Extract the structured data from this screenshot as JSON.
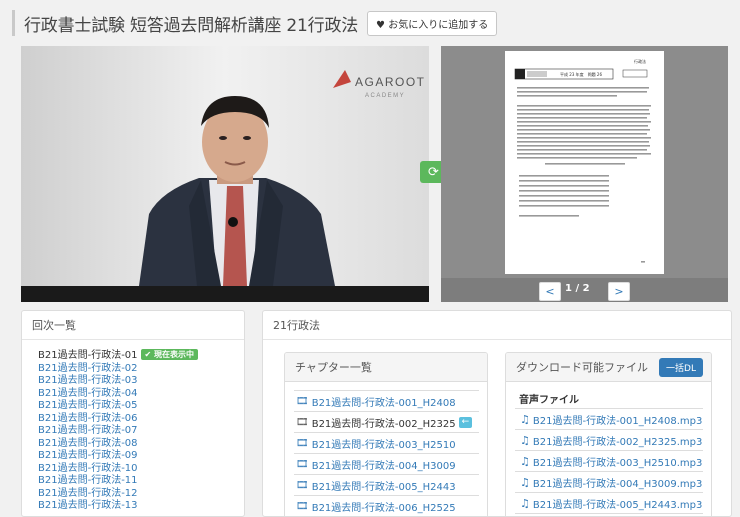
{
  "header": {
    "title": "行政書士試験 短答過去問解析講座 21行政法",
    "favorite_label": "お気に入りに追加する"
  },
  "video": {
    "logo_text": "AGAROOT",
    "logo_sub": "ACADEMY"
  },
  "doc": {
    "page_indicator": "1 / 2",
    "header_small": "行政法",
    "header_box": "平成 23 年度　問題 26",
    "prev": "<",
    "next": ">"
  },
  "episodes": {
    "title": "回次一覧",
    "current_badge": "現在表示中",
    "items": [
      "B21過去問-行政法-01",
      "B21過去問-行政法-02",
      "B21過去問-行政法-03",
      "B21過去問-行政法-04",
      "B21過去問-行政法-05",
      "B21過去問-行政法-06",
      "B21過去問-行政法-07",
      "B21過去問-行政法-08",
      "B21過去問-行政法-09",
      "B21過去問-行政法-10",
      "B21過去問-行政法-11",
      "B21過去問-行政法-12",
      "B21過去問-行政法-13"
    ]
  },
  "course": {
    "title": "21行政法"
  },
  "chapters": {
    "title": "チャプター一覧",
    "items": [
      "B21過去問-行政法-001_H2408",
      "B21過去問-行政法-002_H2325",
      "B21過去問-行政法-003_H2510",
      "B21過去問-行政法-004_H3009",
      "B21過去問-行政法-005_H2443",
      "B21過去問-行政法-006_H2525"
    ]
  },
  "downloads": {
    "title": "ダウンロード可能ファイル",
    "bulk_label": "一括DL",
    "audio_heading": "音声ファイル",
    "items": [
      "B21過去問-行政法-001_H2408.mp3",
      "B21過去問-行政法-002_H2325.mp3",
      "B21過去問-行政法-003_H2510.mp3",
      "B21過去問-行政法-004_H3009.mp3",
      "B21過去問-行政法-005_H2443.mp3"
    ]
  }
}
